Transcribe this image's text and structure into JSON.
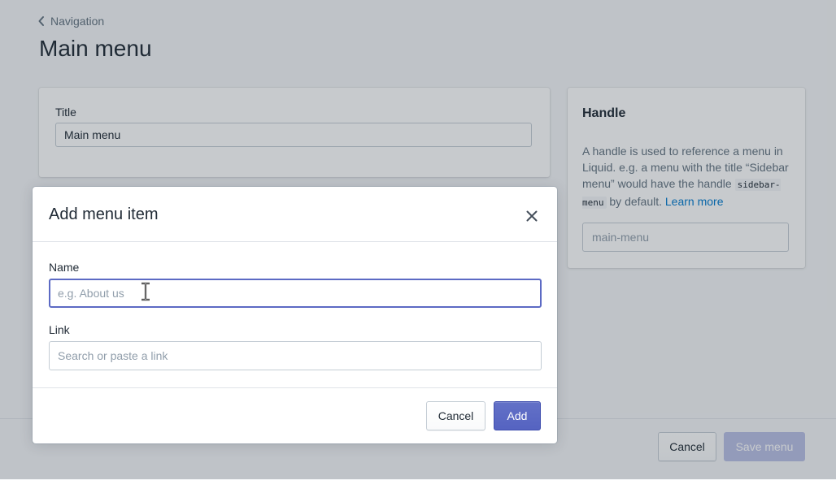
{
  "breadcrumb": {
    "label": "Navigation",
    "icon": "chevron-left-icon"
  },
  "page": {
    "title": "Main menu"
  },
  "title_card": {
    "label": "Title",
    "value": "Main menu"
  },
  "handle_card": {
    "heading": "Handle",
    "description_pre": "A handle is used to reference a menu in Liquid. e.g. a menu with the title “Sidebar menu” would have the handle ",
    "code": "sidebar-menu",
    "description_post": " by default. ",
    "learn_more": "Learn more",
    "placeholder": "main-menu"
  },
  "footer": {
    "cancel_label": "Cancel",
    "save_label": "Save menu"
  },
  "modal": {
    "title": "Add menu item",
    "close_icon": "close-icon",
    "name_label": "Name",
    "name_placeholder": "e.g. About us",
    "link_label": "Link",
    "link_placeholder": "Search or paste a link",
    "cancel_label": "Cancel",
    "add_label": "Add"
  },
  "colors": {
    "primary": "#5c6ac4",
    "link": "#007ace",
    "text": "#212b36",
    "muted": "#637381",
    "border": "#c4cdd5"
  }
}
